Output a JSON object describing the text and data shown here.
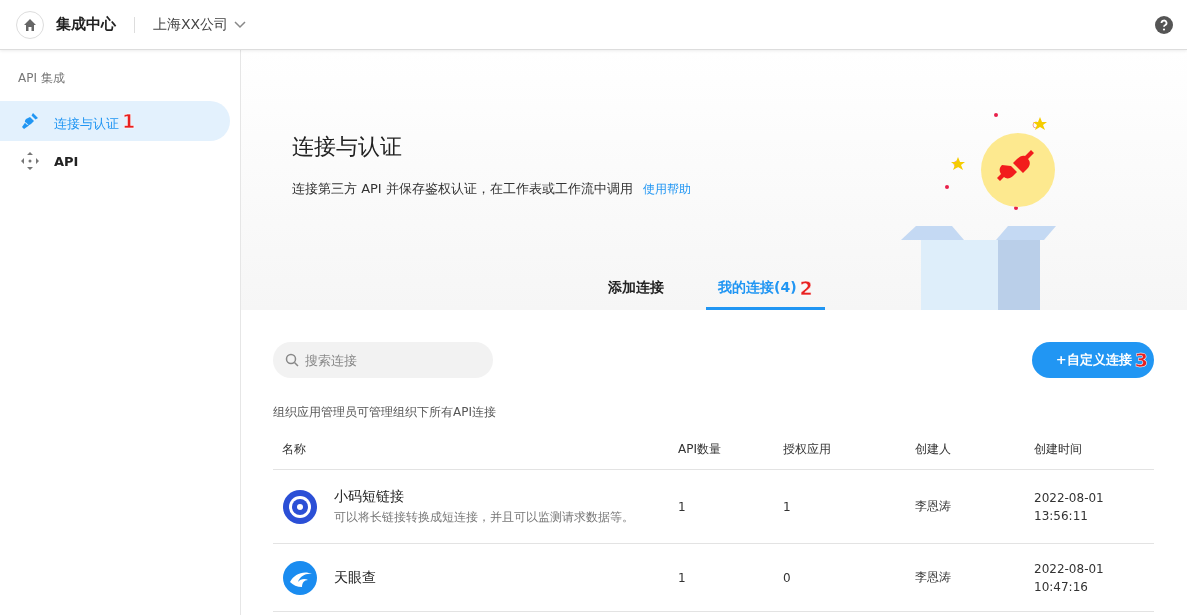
{
  "header": {
    "title": "集成中心",
    "company": "上海XX公司"
  },
  "sidebar": {
    "section": "API 集成",
    "items": [
      {
        "label": "连接与认证",
        "kind": "plug",
        "selected": true,
        "annotation": "1"
      },
      {
        "label": "API",
        "kind": "move",
        "selected": false
      }
    ]
  },
  "hero": {
    "title": "连接与认证",
    "description": "连接第三方 API 并保存鉴权认证，在工作表或工作流中调用",
    "help_link": "使用帮助"
  },
  "tabs": [
    {
      "label": "添加连接",
      "selected": false
    },
    {
      "label": "我的连接(4)",
      "selected": true,
      "annotation": "2"
    }
  ],
  "search": {
    "placeholder": "搜索连接"
  },
  "add_button": {
    "label": "+自定义连接",
    "annotation": "3"
  },
  "note": "组织应用管理员可管理组织下所有API连接",
  "table": {
    "columns": [
      "名称",
      "API数量",
      "授权应用",
      "创建人",
      "创建时间"
    ],
    "rows": [
      {
        "kind": "ring",
        "name": "小码短链接",
        "description": "可以将长链接转换成短连接，并且可以监测请求数据等。",
        "api_count": "1",
        "apps": "1",
        "creator": "李恩涛",
        "date": "2022-08-01",
        "time": "13:56:11"
      },
      {
        "kind": "swirl",
        "name": "天眼查",
        "api_count": "1",
        "apps": "0",
        "creator": "李恩涛",
        "date": "2022-08-01",
        "time": "10:47:16"
      }
    ]
  }
}
